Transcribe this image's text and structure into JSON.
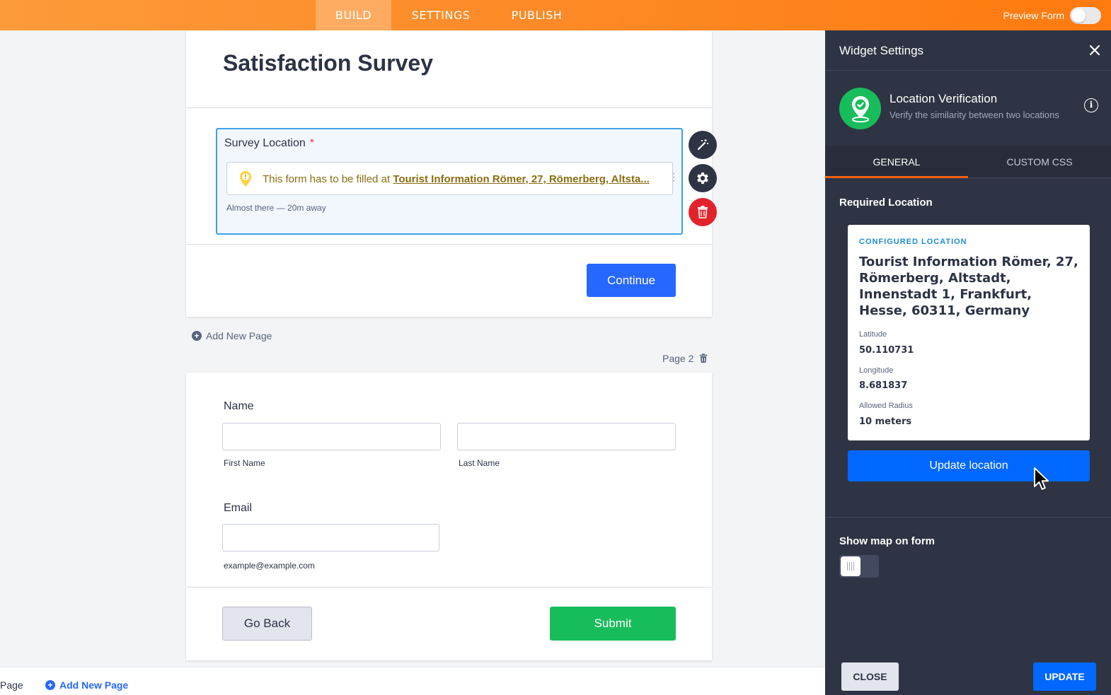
{
  "topbar": {
    "tabs": [
      {
        "label": "BUILD",
        "active": true
      },
      {
        "label": "SETTINGS",
        "active": false
      },
      {
        "label": "PUBLISH",
        "active": false
      }
    ],
    "preview_label": "Preview Form",
    "preview_on": false
  },
  "form": {
    "title": "Satisfaction Survey",
    "location_field": {
      "label": "Survey Location",
      "required_mark": "*",
      "message_prefix": "This form has to be filled at",
      "message_location": "Tourist Information Römer, 27, Römerberg, Altsta...",
      "status": "Almost there — 20m away"
    },
    "continue_label": "Continue",
    "add_new_page": "Add New Page",
    "page2_label": "Page 2",
    "name": {
      "label": "Name",
      "first_sublabel": "First Name",
      "last_sublabel": "Last Name",
      "first_value": "",
      "last_value": ""
    },
    "email": {
      "label": "Email",
      "value": "",
      "sublabel": "example@example.com"
    },
    "go_back_label": "Go Back",
    "submit_label": "Submit"
  },
  "bottom_bar": {
    "page_label": "Page",
    "add_new_page": "Add New Page"
  },
  "panel": {
    "title": "Widget Settings",
    "widget_name": "Location Verification",
    "widget_desc": "Verify the similarity between two locations",
    "info_glyph": "i",
    "tabs": [
      {
        "label": "GENERAL",
        "active": true
      },
      {
        "label": "CUSTOM CSS",
        "active": false
      }
    ],
    "required_location_title": "Required Location",
    "card": {
      "label": "CONFIGURED LOCATION",
      "address": "Tourist Information Römer, 27, Römerberg, Altstadt, Innenstadt 1, Frankfurt, Hesse, 60311, Germany",
      "latitude_label": "Latitude",
      "latitude": "50.110731",
      "longitude_label": "Longitude",
      "longitude": "8.681837",
      "radius_label": "Allowed Radius",
      "radius": "10 meters"
    },
    "update_location_label": "Update location",
    "show_map_title": "Show map on form",
    "show_map_on": false,
    "close_label": "CLOSE",
    "update_label": "UPDATE"
  },
  "colors": {
    "accent_orange": "#ff7a0f",
    "primary_blue": "#2667ff",
    "panel_bg": "#2f3444",
    "success_green": "#18bd5b",
    "danger_red": "#e3232c"
  }
}
